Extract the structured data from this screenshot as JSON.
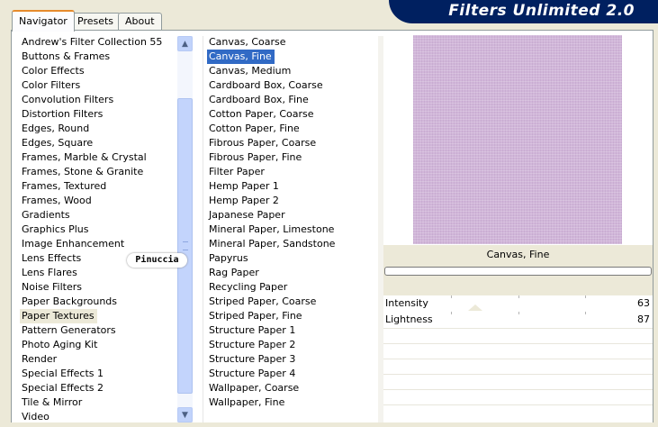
{
  "tabs": [
    "Navigator",
    "Presets",
    "About"
  ],
  "app_title": "Filters Unlimited 2.0",
  "categories": [
    "Andrew's Filter Collection 55",
    "Buttons & Frames",
    "Color Effects",
    "Color Filters",
    "Convolution Filters",
    "Distortion Filters",
    "Edges, Round",
    "Edges, Square",
    "Frames, Marble & Crystal",
    "Frames, Stone & Granite",
    "Frames, Textured",
    "Frames, Wood",
    "Gradients",
    "Graphics Plus",
    "Image Enhancement",
    "Lens Effects",
    "Lens Flares",
    "Noise Filters",
    "Paper Backgrounds",
    "Paper Textures",
    "Pattern Generators",
    "Photo Aging Kit",
    "Render",
    "Special Effects 1",
    "Special Effects 2",
    "Tile & Mirror",
    "Video"
  ],
  "selected_category": "Paper Textures",
  "filters": [
    "Canvas, Coarse",
    "Canvas, Fine",
    "Canvas, Medium",
    "Cardboard Box, Coarse",
    "Cardboard Box, Fine",
    "Cotton Paper, Coarse",
    "Cotton Paper, Fine",
    "Fibrous Paper, Coarse",
    "Fibrous Paper, Fine",
    "Filter Paper",
    "Hemp Paper 1",
    "Hemp Paper 2",
    "Japanese Paper",
    "Mineral Paper, Limestone",
    "Mineral Paper, Sandstone",
    "Papyrus",
    "Rag Paper",
    "Recycling Paper",
    "Striped Paper, Coarse",
    "Striped Paper, Fine",
    "Structure Paper 1",
    "Structure Paper 2",
    "Structure Paper 3",
    "Structure Paper 4",
    "Wallpaper, Coarse",
    "Wallpaper, Fine"
  ],
  "selected_filter": "Canvas, Fine",
  "preview": {
    "caption": "Canvas, Fine",
    "color": "#d1b6d9"
  },
  "sliders": [
    {
      "label": "Intensity",
      "value": "63",
      "level": 0.25
    },
    {
      "label": "Lightness",
      "value": "87",
      "level": 0.34
    }
  ],
  "watermark": "Pinuccia",
  "icons": {
    "scroll_up": "chevron-up-icon",
    "scroll_down": "chevron-down-icon"
  }
}
